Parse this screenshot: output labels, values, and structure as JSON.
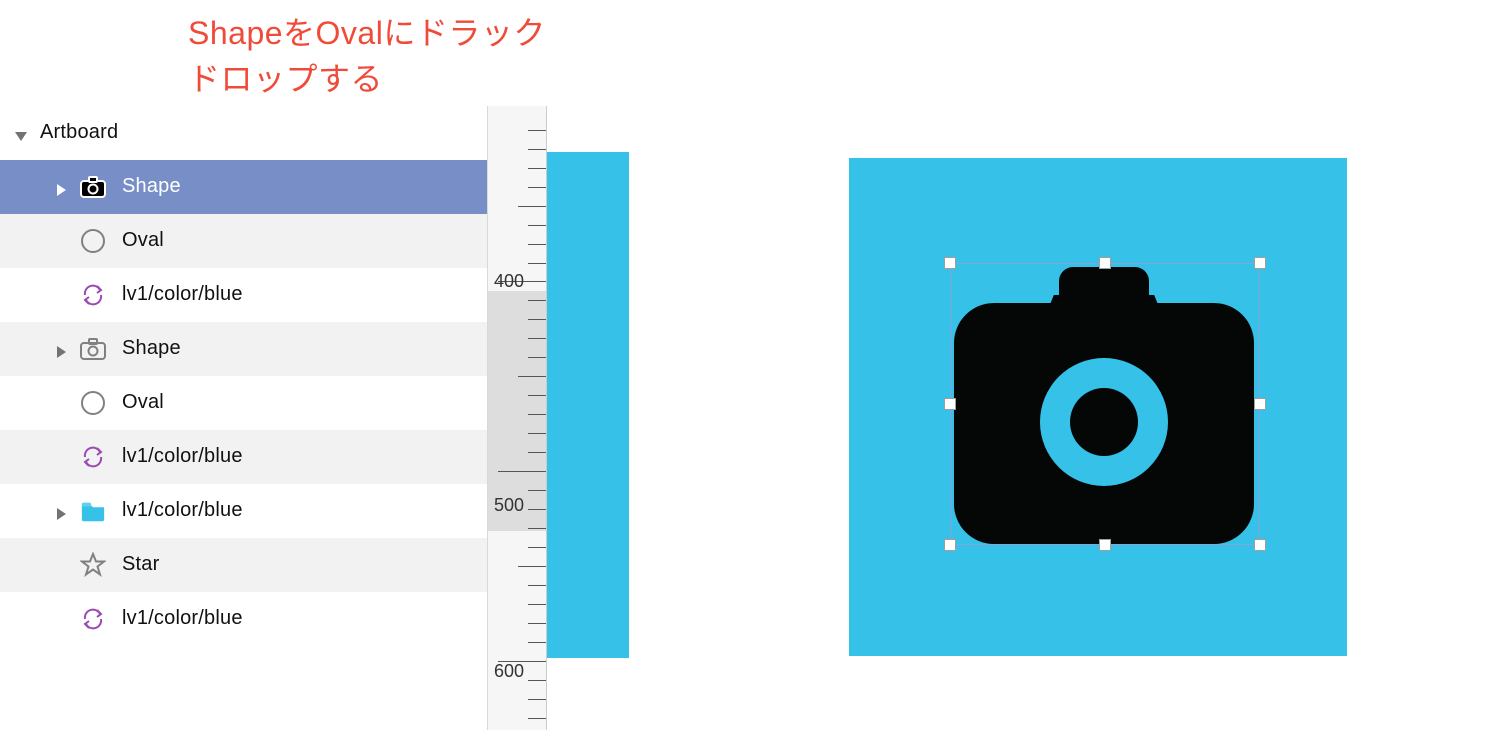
{
  "annotation": {
    "line1": "ShapeをOvalにドラック＆",
    "line2": "ドロップする"
  },
  "layers": {
    "header": "Artboard",
    "items": [
      {
        "label": "Shape",
        "icon": "camera",
        "selected": true,
        "expandable": true,
        "open": false
      },
      {
        "label": "Oval",
        "icon": "oval",
        "selected": false,
        "expandable": false
      },
      {
        "label": "lv1/color/blue",
        "icon": "sync",
        "selected": false,
        "expandable": false
      },
      {
        "label": "Shape",
        "icon": "camera",
        "selected": false,
        "expandable": true,
        "open": false
      },
      {
        "label": "Oval",
        "icon": "oval",
        "selected": false,
        "expandable": false
      },
      {
        "label": "lv1/color/blue",
        "icon": "sync",
        "selected": false,
        "expandable": false
      },
      {
        "label": "lv1/color/blue",
        "icon": "folder",
        "selected": false,
        "expandable": true,
        "open": false
      },
      {
        "label": "Star",
        "icon": "star",
        "selected": false,
        "expandable": false
      },
      {
        "label": "lv1/color/blue",
        "icon": "sync",
        "selected": false,
        "expandable": false
      }
    ]
  },
  "ruler": {
    "labels": [
      "400",
      "500",
      "600"
    ]
  },
  "colors": {
    "accent_blue": "#36C2E8",
    "selection_blue": "#778EC6",
    "annotation_red": "#F04A39",
    "camera_black": "#050707"
  }
}
